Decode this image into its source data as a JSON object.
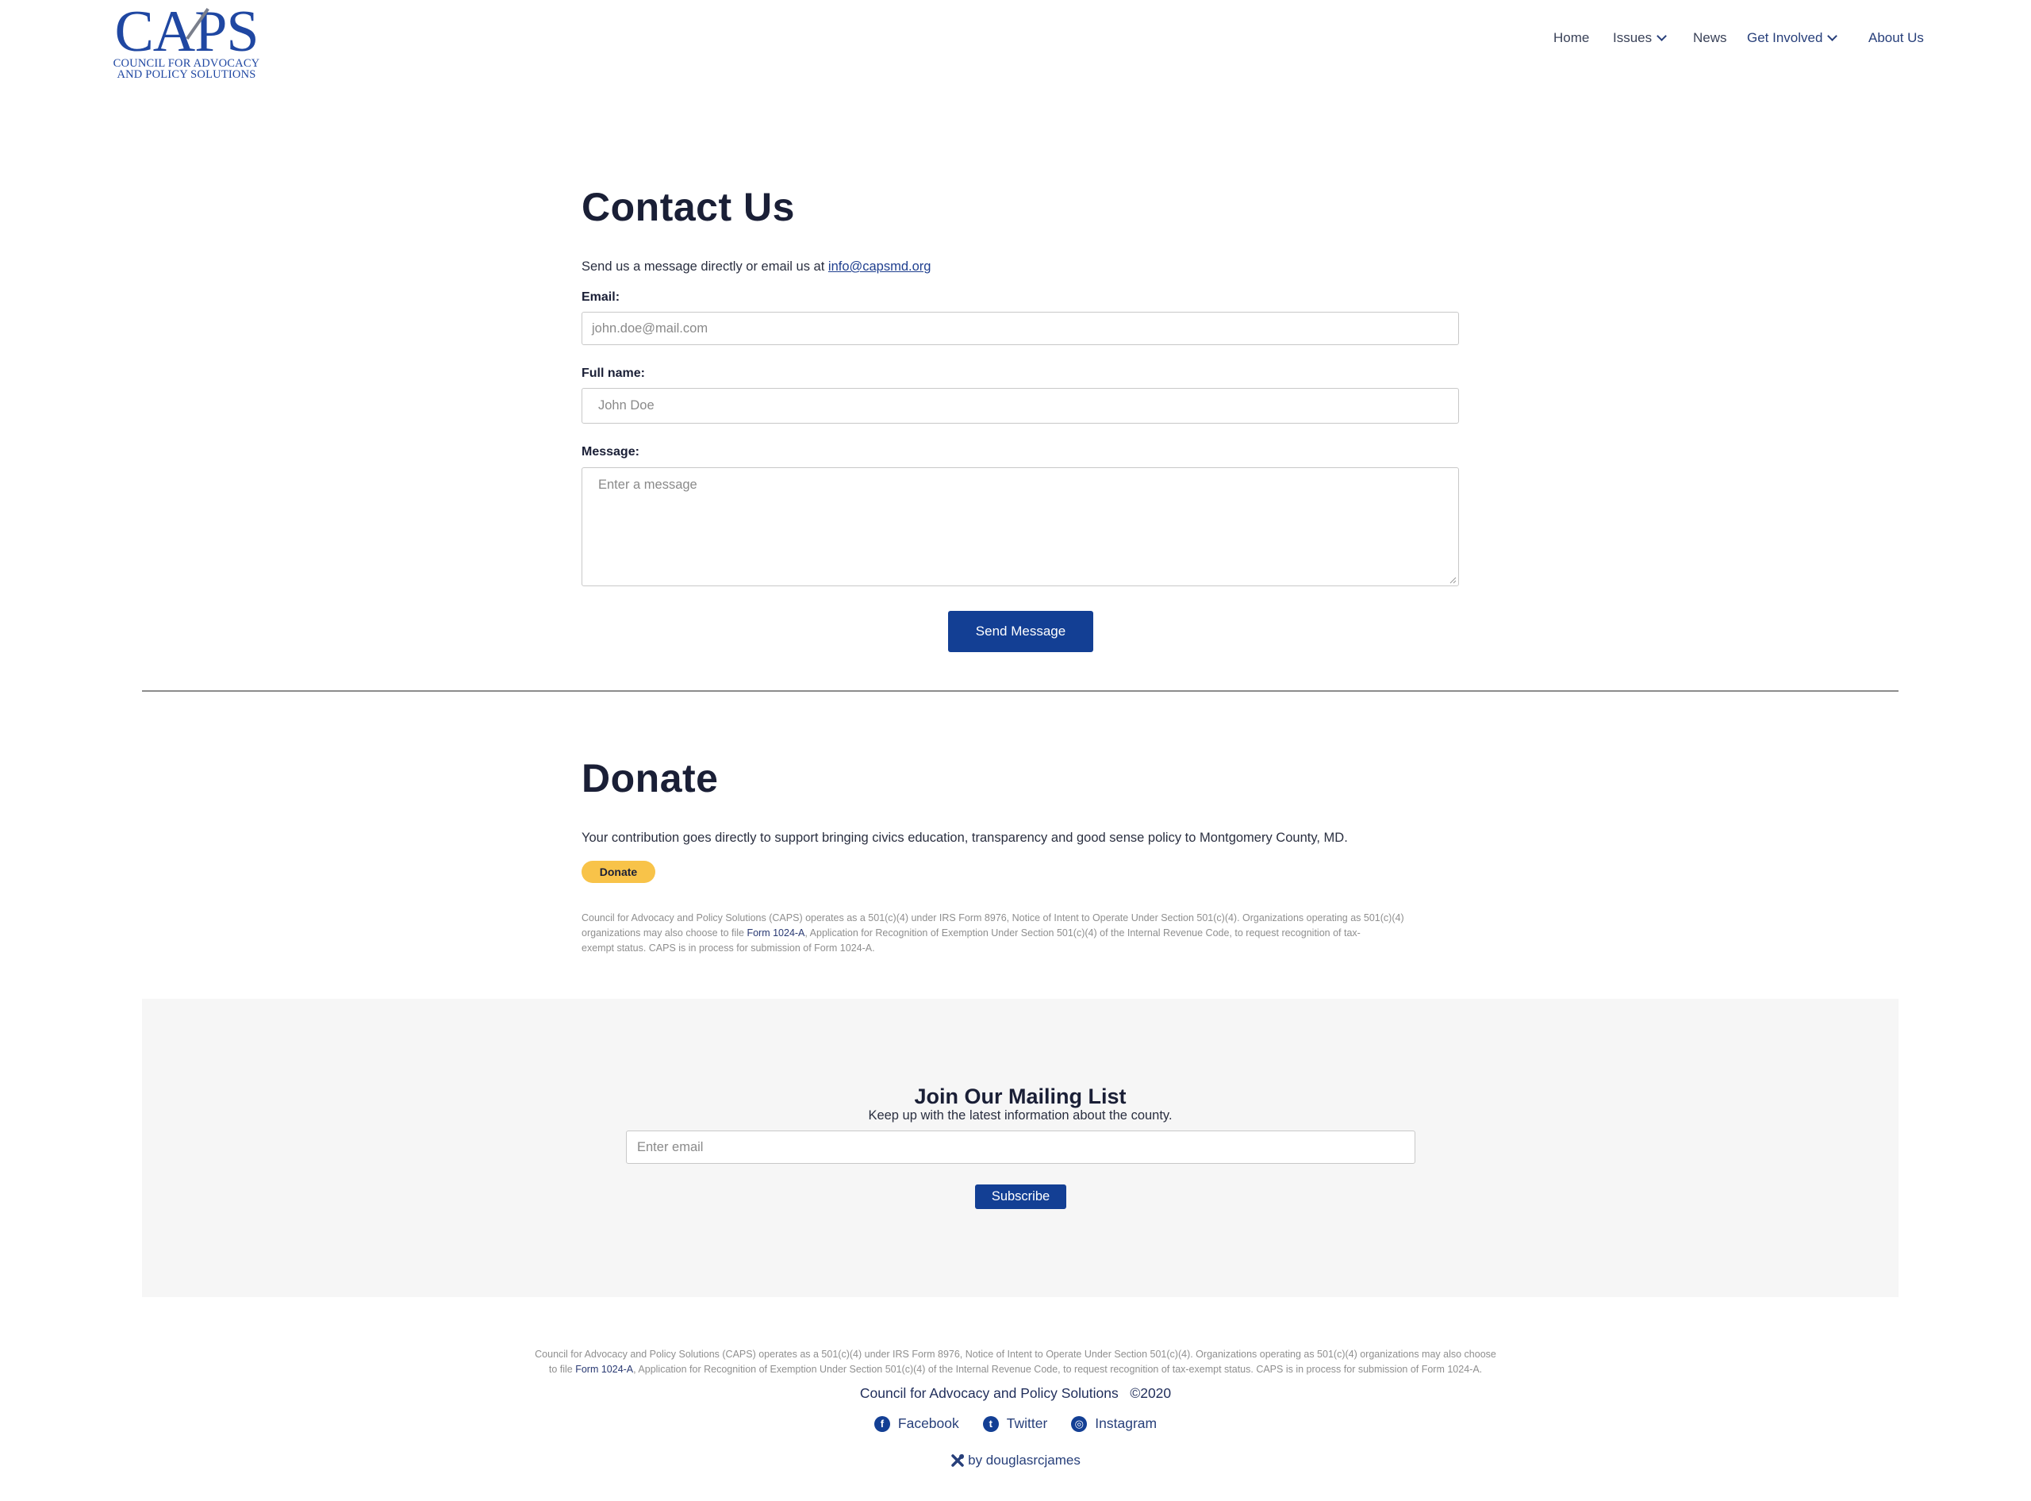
{
  "header": {
    "logo": {
      "wordmark": "CAPS",
      "line1": "COUNCIL FOR ADVOCACY",
      "line2": "AND POLICY SOLUTIONS"
    },
    "nav": [
      {
        "label": "Home",
        "has_dropdown": false
      },
      {
        "label": "Issues",
        "has_dropdown": true
      },
      {
        "label": "News",
        "has_dropdown": false
      },
      {
        "label": "Get Involved",
        "has_dropdown": true
      },
      {
        "label": "About Us",
        "has_dropdown": false
      }
    ]
  },
  "contact": {
    "title": "Contact Us",
    "intro_text": "Send us a message directly or email us at ",
    "intro_link": "info@capsmd.org",
    "email_label": "Email:",
    "email_placeholder": "john.doe@mail.com",
    "name_label": "Full name:",
    "name_placeholder": "John Doe",
    "message_label": "Message:",
    "message_placeholder": "Enter a message",
    "submit_label": "Send Message"
  },
  "donate": {
    "title": "Donate",
    "text": "Your contribution goes directly to support bringing civics education, transparency and good sense policy to Montgomery County, MD.",
    "button_label": "Donate",
    "fine_print_1": "Council for Advocacy and Policy Solutions (CAPS) operates as a 501(c)(4) under IRS Form 8976, Notice of Intent to Operate Under Section 501(c)(4). Organizations operating as 501(c)(4)",
    "fine_print_2a": "organizations may also choose to file ",
    "fine_print_2_link": "Form 1024-A",
    "fine_print_2b": ", Application for Recognition of Exemption Under Section 501(c)(4) of the Internal Revenue Code, to request recognition of tax-",
    "fine_print_3": "exempt status. CAPS is in process for submission of Form 1024-A."
  },
  "mailing": {
    "title": "Join Our Mailing List",
    "subtitle": "Keep up with the latest information about the county.",
    "email_placeholder": "Enter email",
    "button_label": "Subscribe"
  },
  "footer": {
    "fine_print_1": "Council for Advocacy and Policy Solutions (CAPS) operates as a 501(c)(4) under IRS Form 8976, Notice of Intent to Operate Under Section 501(c)(4). Organizations operating as 501(c)(4) organizations may also choose",
    "fine_print_2a": "to file ",
    "fine_print_2_link": "Form 1024-A",
    "fine_print_2b": ", Application for Recognition of Exemption Under Section 501(c)(4) of the Internal Revenue Code, to request recognition of tax-exempt status. CAPS is in process for submission of Form 1024-A.",
    "copyright": "Council for Advocacy and Policy Solutions   ©2020",
    "social": [
      {
        "label": "Facebook",
        "icon": "facebook-icon",
        "glyph": "f"
      },
      {
        "label": "Twitter",
        "icon": "twitter-icon",
        "glyph": "t"
      },
      {
        "label": "Instagram",
        "icon": "instagram-icon",
        "glyph": "◎"
      }
    ],
    "credit": "by douglasrcjames"
  },
  "colors": {
    "brand_blue": "#133f94",
    "heading": "#1a1f36",
    "donate_yellow": "#f8c349",
    "panel_gray": "#f6f6f6"
  }
}
